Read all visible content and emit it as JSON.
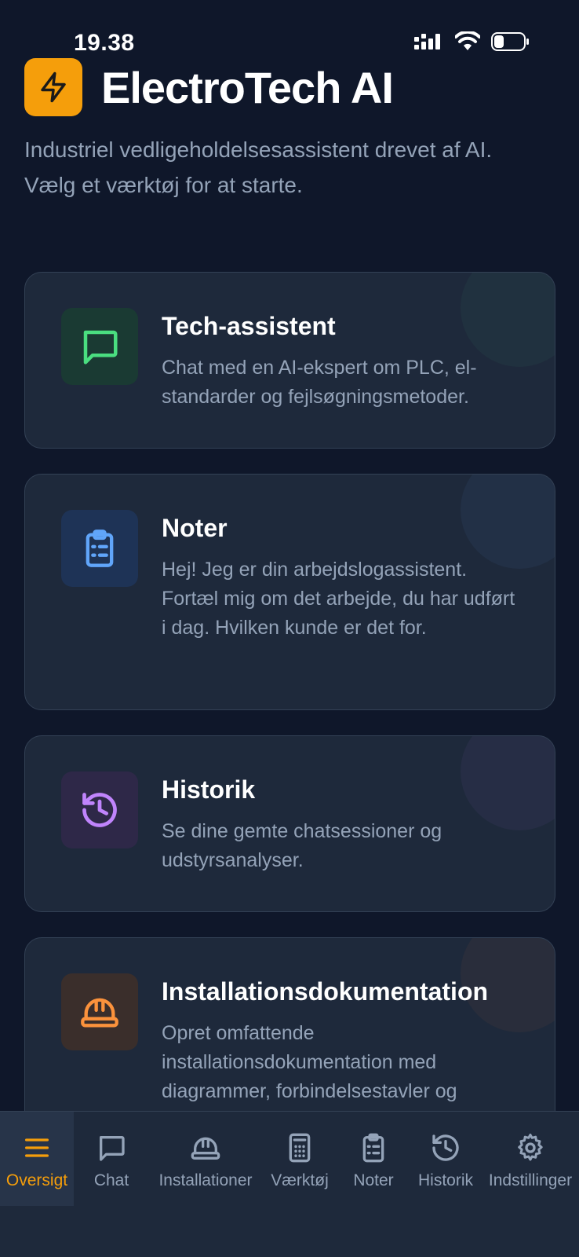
{
  "status_bar": {
    "time": "19.38"
  },
  "header": {
    "title": "ElectroTech AI",
    "subtitle": "Industriel vedligeholdelsesassistent drevet af AI. Vælg et værktøj for at starte."
  },
  "cards": [
    {
      "title": "Tech-assistent",
      "description": "Chat med en AI-ekspert om PLC, el-standarder og fejlsøgningsmetoder.",
      "icon": "chat-icon",
      "color": "#4ade80",
      "icon_bg": "#1a3a33"
    },
    {
      "title": "Noter",
      "description": "Hej! Jeg er din arbejdslogassistent. Fortæl mig om det arbejde, du har udført i dag. Hvilken kunde er det for.",
      "icon": "clipboard-icon",
      "color": "#60a5fa",
      "icon_bg": "#1e3356"
    },
    {
      "title": "Historik",
      "description": "Se dine gemte chatsessioner og udstyrsanalyser.",
      "icon": "history-icon",
      "color": "#c084fc",
      "icon_bg": "#2e2848"
    },
    {
      "title": "Installationsdokumentation",
      "description": "Opret omfattende installationsdokumentation med diagrammer, forbindelsestavler og",
      "icon": "hardhat-icon",
      "color": "#fb923c",
      "icon_bg": "#3a2e2b"
    }
  ],
  "bottom_nav": [
    {
      "label": "Oversigt",
      "icon": "menu-icon",
      "active": true
    },
    {
      "label": "Chat",
      "icon": "chat-icon"
    },
    {
      "label": "Installationer",
      "icon": "hardhat-icon"
    },
    {
      "label": "Værktøj",
      "icon": "calculator-icon"
    },
    {
      "label": "Noter",
      "icon": "clipboard-icon"
    },
    {
      "label": "Historik",
      "icon": "history-icon"
    },
    {
      "label": "Indstillinger",
      "icon": "gear-icon"
    }
  ],
  "colors": {
    "accent": "#f59e0b",
    "background": "#0f172a",
    "card": "#1e293b"
  }
}
